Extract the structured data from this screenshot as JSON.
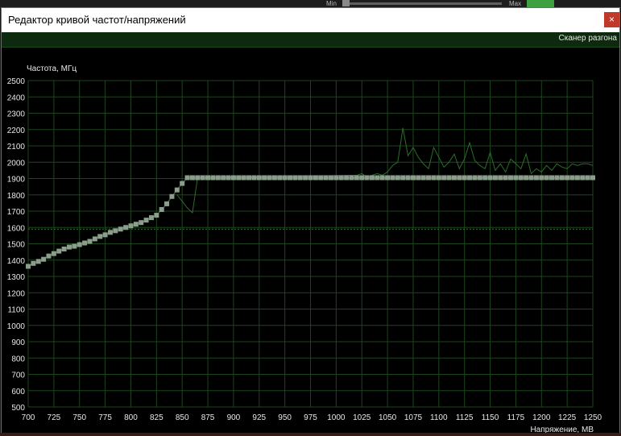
{
  "background": {
    "min_label": "Min",
    "max_label": "Max"
  },
  "window": {
    "title": "Редактор кривой частот/напряжений",
    "close_icon": "close-icon",
    "toolbar": {
      "scanner_label": "Сканер разгона"
    }
  },
  "colors": {
    "grid": "#1d451d",
    "accent": "#1f4a1f",
    "curve": "#8b9e8b",
    "monitor": "#2b6e2b",
    "text": "#e8e8e8",
    "close": "#c0392b"
  },
  "chart_data": {
    "type": "line",
    "title": "",
    "xlabel": "Напряжение, МВ",
    "ylabel": "Частота, МГц",
    "xlim": [
      700,
      1250
    ],
    "ylim": [
      500,
      2500
    ],
    "x_ticks": [
      700,
      725,
      750,
      775,
      800,
      825,
      850,
      875,
      900,
      925,
      950,
      975,
      1000,
      1025,
      1050,
      1075,
      1100,
      1125,
      1150,
      1175,
      1200,
      1225,
      1250
    ],
    "y_ticks": [
      500,
      600,
      700,
      800,
      900,
      1000,
      1100,
      1200,
      1300,
      1400,
      1500,
      1600,
      1700,
      1800,
      1900,
      2000,
      2100,
      2200,
      2300,
      2400,
      2500
    ],
    "grid": true,
    "reference_line": 1590,
    "series": [
      {
        "style": "points",
        "x": [
          700,
          705,
          710,
          715,
          720,
          725,
          730,
          735,
          740,
          745,
          750,
          755,
          760,
          765,
          770,
          775,
          780,
          785,
          790,
          795,
          800,
          805,
          810,
          815,
          820,
          825,
          830,
          835,
          840,
          845,
          850,
          855,
          860,
          865,
          870,
          875,
          880,
          885,
          890,
          895,
          900,
          905,
          910,
          915,
          920,
          925,
          930,
          935,
          940,
          945,
          950,
          955,
          960,
          965,
          970,
          975,
          980,
          985,
          990,
          995,
          1000,
          1005,
          1010,
          1015,
          1020,
          1025,
          1030,
          1035,
          1040,
          1045,
          1050,
          1055,
          1060,
          1065,
          1070,
          1075,
          1080,
          1085,
          1090,
          1095,
          1100,
          1105,
          1110,
          1115,
          1120,
          1125,
          1130,
          1135,
          1140,
          1145,
          1150,
          1155,
          1160,
          1165,
          1170,
          1175,
          1180,
          1185,
          1190,
          1195,
          1200,
          1205,
          1210,
          1215,
          1220,
          1225,
          1230,
          1235,
          1240,
          1245,
          1250
        ],
        "y": [
          1362,
          1380,
          1392,
          1405,
          1425,
          1440,
          1455,
          1468,
          1480,
          1485,
          1495,
          1505,
          1515,
          1530,
          1545,
          1555,
          1570,
          1580,
          1590,
          1600,
          1610,
          1620,
          1630,
          1645,
          1660,
          1675,
          1710,
          1745,
          1790,
          1830,
          1870,
          1905,
          1905,
          1905,
          1905,
          1905,
          1905,
          1905,
          1905,
          1905,
          1905,
          1905,
          1905,
          1905,
          1905,
          1905,
          1905,
          1905,
          1905,
          1905,
          1905,
          1905,
          1905,
          1905,
          1905,
          1905,
          1905,
          1905,
          1905,
          1905,
          1905,
          1905,
          1905,
          1905,
          1905,
          1905,
          1905,
          1905,
          1905,
          1905,
          1905,
          1905,
          1905,
          1905,
          1905,
          1905,
          1905,
          1905,
          1905,
          1905,
          1905,
          1905,
          1905,
          1905,
          1905,
          1905,
          1905,
          1905,
          1905,
          1905,
          1905,
          1905,
          1905,
          1905,
          1905,
          1905,
          1905,
          1905,
          1905,
          1905,
          1905,
          1905,
          1905,
          1905,
          1905,
          1905,
          1905,
          1905,
          1905,
          1905,
          1905
        ]
      },
      {
        "style": "line",
        "x": [
          845,
          850,
          855,
          860,
          865,
          1020,
          1025,
          1030,
          1035,
          1040,
          1045,
          1050,
          1055,
          1060,
          1065,
          1070,
          1075,
          1080,
          1085,
          1090,
          1095,
          1100,
          1105,
          1110,
          1115,
          1120,
          1125,
          1130,
          1135,
          1140,
          1145,
          1150,
          1155,
          1160,
          1165,
          1170,
          1175,
          1180,
          1185,
          1190,
          1195,
          1200,
          1205,
          1210,
          1215,
          1220,
          1225,
          1230,
          1235,
          1240,
          1245,
          1250
        ],
        "y": [
          1800,
          1760,
          1720,
          1690,
          1905,
          1920,
          1930,
          1910,
          1920,
          1930,
          1920,
          1940,
          1980,
          2000,
          2210,
          2040,
          2090,
          2030,
          1990,
          1960,
          2090,
          2030,
          1970,
          2000,
          2050,
          1960,
          2020,
          2120,
          2010,
          1980,
          1960,
          2060,
          1950,
          1990,
          1940,
          2020,
          1990,
          1960,
          2050,
          1930,
          1960,
          1940,
          1980,
          1950,
          1990,
          1970,
          1960,
          1990,
          1980,
          1990,
          1990,
          1980
        ]
      }
    ]
  }
}
